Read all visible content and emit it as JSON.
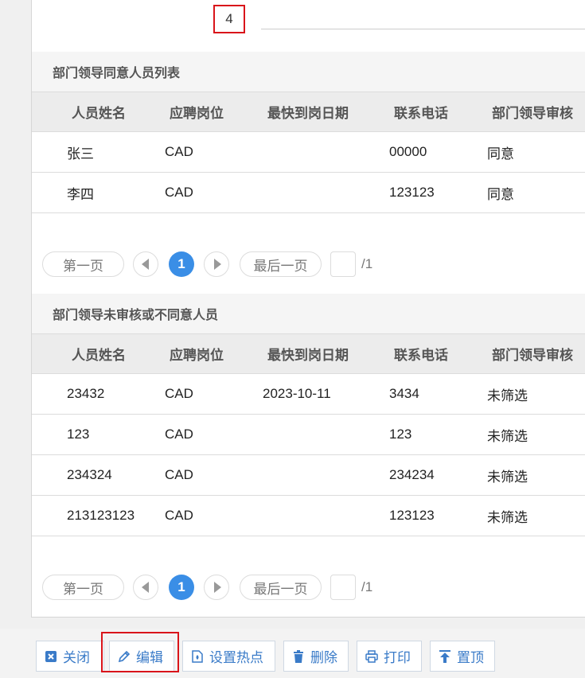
{
  "top_field": {
    "value": "4"
  },
  "columns": [
    "人员姓名",
    "应聘岗位",
    "最快到岗日期",
    "联系电话",
    "部门领导审核"
  ],
  "section1": {
    "title": "部门领导同意人员列表",
    "rows": [
      [
        "张三",
        "CAD",
        "",
        "00000",
        "同意"
      ],
      [
        "李四",
        "CAD",
        "",
        "123123",
        "同意"
      ]
    ]
  },
  "section2": {
    "title": "部门领导未审核或不同意人员",
    "rows": [
      [
        "23432",
        "CAD",
        "2023-10-11",
        "3434",
        "未筛选"
      ],
      [
        "123",
        "CAD",
        "",
        "123",
        "未筛选"
      ],
      [
        "234324",
        "CAD",
        "",
        "234234",
        "未筛选"
      ],
      [
        "213123123",
        "CAD",
        "",
        "123123",
        "未筛选"
      ]
    ]
  },
  "pager": {
    "first": "第一页",
    "last": "最后一页",
    "current": "1",
    "total": "/1"
  },
  "toolbar": {
    "close": "关闭",
    "edit": "编辑",
    "set_hotspot": "设置热点",
    "delete": "删除",
    "print": "打印",
    "pin_top": "置顶"
  },
  "colors": {
    "accent": "#3a8ee6",
    "highlight": "#d9141a",
    "button_text": "#3a7bc8"
  }
}
